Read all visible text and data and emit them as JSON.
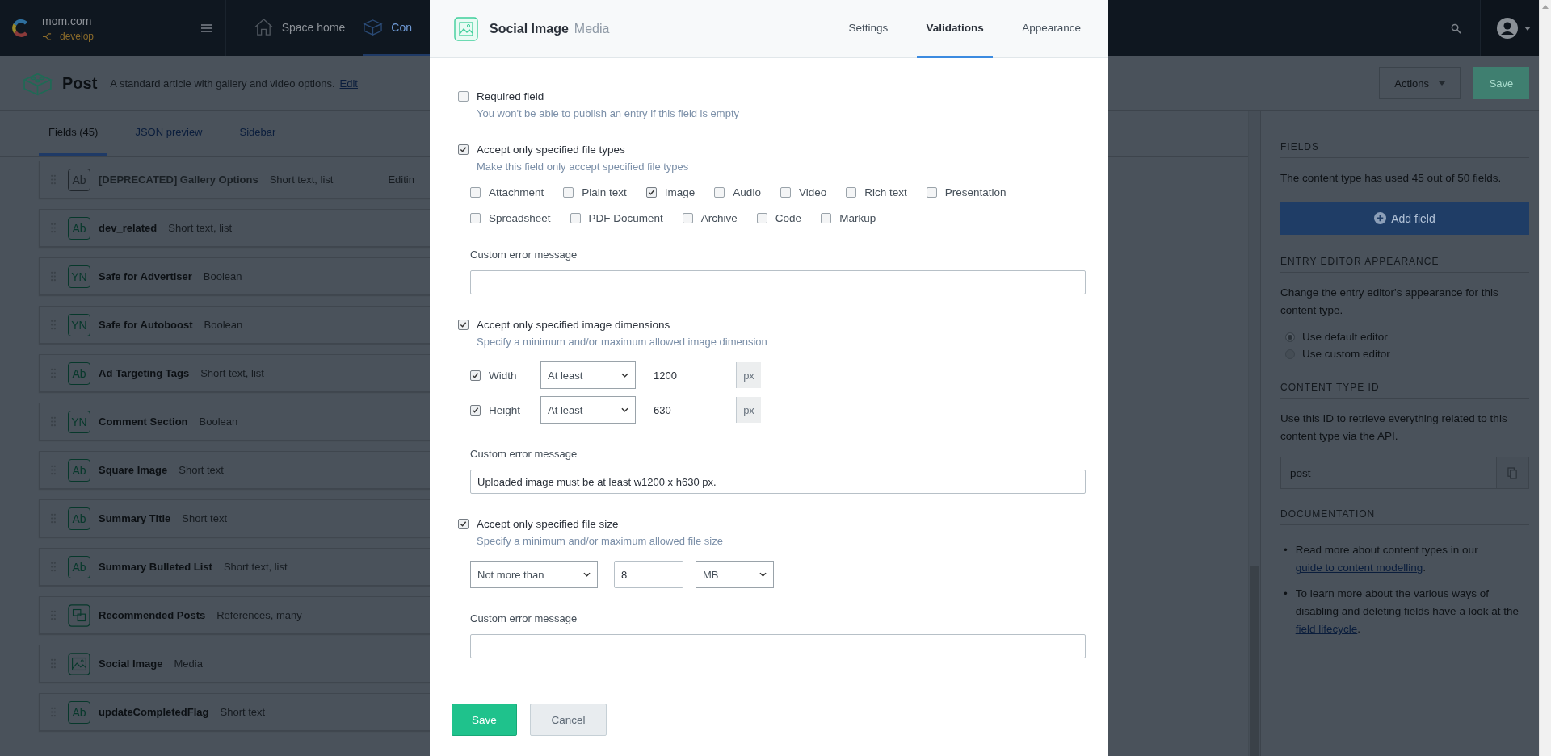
{
  "topbar": {
    "org": "mom.com",
    "environment": "develop",
    "nav": [
      {
        "label": "Space home",
        "selected": false
      },
      {
        "label": "Con",
        "selected": true
      }
    ]
  },
  "content_type": {
    "name": "Post",
    "description": "A standard article with gallery and video options.",
    "edit_link": "Edit",
    "actions": "Actions",
    "save": "Save"
  },
  "tabs": [
    {
      "label": "Fields (45)",
      "selected": true
    },
    {
      "label": "JSON preview",
      "selected": false
    },
    {
      "label": "Sidebar",
      "selected": false
    }
  ],
  "fields": [
    {
      "kind": "text",
      "badge": "Ab",
      "name": "[DEPRECATED] Gallery Options",
      "type": "Short text, list",
      "status": "Editin",
      "disabled": true
    },
    {
      "kind": "text",
      "badge": "Ab",
      "name": "dev_related",
      "type": "Short text, list",
      "disabled": false
    },
    {
      "kind": "boolean",
      "badge": "YN",
      "name": "Safe for Advertiser",
      "type": "Boolean",
      "disabled": false
    },
    {
      "kind": "boolean",
      "badge": "YN",
      "name": "Safe for Autoboost",
      "type": "Boolean",
      "disabled": false
    },
    {
      "kind": "text",
      "badge": "Ab",
      "name": "Ad Targeting Tags",
      "type": "Short text, list",
      "disabled": false
    },
    {
      "kind": "boolean",
      "badge": "YN",
      "name": "Comment Section",
      "type": "Boolean",
      "disabled": false
    },
    {
      "kind": "text",
      "badge": "Ab",
      "name": "Square Image",
      "type": "Short text",
      "disabled": false
    },
    {
      "kind": "text",
      "badge": "Ab",
      "name": "Summary Title",
      "type": "Short text",
      "disabled": false
    },
    {
      "kind": "text",
      "badge": "Ab",
      "name": "Summary Bulleted List",
      "type": "Short text, list",
      "disabled": false
    },
    {
      "kind": "reference",
      "name": "Recommended Posts",
      "type": "References, many",
      "disabled": false
    },
    {
      "kind": "media",
      "name": "Social Image",
      "type": "Media",
      "disabled": false
    },
    {
      "kind": "text",
      "badge": "Ab",
      "name": "updateCompletedFlag",
      "type": "Short text",
      "disabled": false
    }
  ],
  "modal": {
    "title": "Social Image",
    "subtitle": "Media",
    "tabs": [
      {
        "label": "Settings",
        "selected": false
      },
      {
        "label": "Validations",
        "selected": true
      },
      {
        "label": "Appearance",
        "selected": false
      }
    ],
    "required": {
      "label": "Required field",
      "hint": "You won't be able to publish an entry if this field is empty",
      "checked": false
    },
    "file_types": {
      "label": "Accept only specified file types",
      "hint": "Make this field only accept specified file types",
      "checked": true,
      "option_rows": [
        [
          {
            "label": "Attachment",
            "checked": false
          },
          {
            "label": "Plain text",
            "checked": false
          },
          {
            "label": "Image",
            "checked": true
          },
          {
            "label": "Audio",
            "checked": false
          },
          {
            "label": "Video",
            "checked": false
          },
          {
            "label": "Rich text",
            "checked": false
          },
          {
            "label": "Presentation",
            "checked": false
          }
        ],
        [
          {
            "label": "Spreadsheet",
            "checked": false
          },
          {
            "label": "PDF Document",
            "checked": false
          },
          {
            "label": "Archive",
            "checked": false
          },
          {
            "label": "Code",
            "checked": false
          },
          {
            "label": "Markup",
            "checked": false
          }
        ]
      ],
      "error_label": "Custom error message"
    },
    "dimensions": {
      "label": "Accept only specified image dimensions",
      "hint": "Specify a minimum and/or maximum allowed image dimension",
      "checked": true,
      "rows": [
        {
          "label": "Width",
          "checked": true,
          "condition": "At least",
          "value": "1200",
          "unit": "px"
        },
        {
          "label": "Height",
          "checked": true,
          "condition": "At least",
          "value": "630",
          "unit": "px"
        }
      ],
      "error_label": "Custom error message",
      "error_message": "Uploaded image must be at least w1200 x h630 px."
    },
    "file_size": {
      "label": "Accept only specified file size",
      "hint": "Specify a minimum and/or maximum allowed file size",
      "checked": true,
      "condition": "Not more than",
      "value": "8",
      "unit": "MB",
      "error_label": "Custom error message"
    },
    "buttons": {
      "save": "Save",
      "cancel": "Cancel"
    }
  },
  "sidebar": {
    "fields_heading": "FIELDS",
    "fields_text": "The content type has used 45 out of 50 fields.",
    "add_field": "Add field",
    "appearance_heading": "ENTRY EDITOR APPEARANCE",
    "appearance_text": "Change the entry editor's appearance for this content type.",
    "editor_options": [
      {
        "label": "Use default editor",
        "selected": true
      },
      {
        "label": "Use custom editor",
        "selected": false
      }
    ],
    "id_heading": "CONTENT TYPE ID",
    "id_text": "Use this ID to retrieve everything related to this content type via the API.",
    "id_value": "post",
    "docs_heading": "DOCUMENTATION",
    "docs": [
      {
        "marker": "•",
        "text": "Read more about content types in our ",
        "link": "guide to content modelling",
        "after": "."
      },
      {
        "marker": "•",
        "text": "To learn more about the various ways of disabling and deleting fields have a look at the ",
        "link": "field lifecycle",
        "after": "."
      }
    ]
  }
}
